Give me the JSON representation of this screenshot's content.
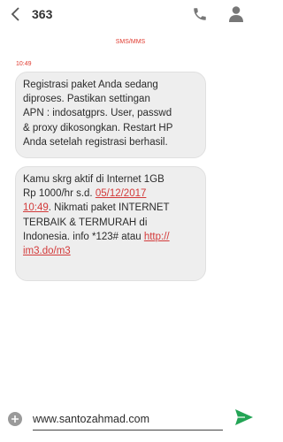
{
  "header": {
    "title": "363"
  },
  "conversation": {
    "channel_label": "SMS/MMS",
    "timestamp": "10:49",
    "messages": [
      {
        "lines": [
          "Registrasi paket Anda sedang",
          "diproses. Pastikan settingan",
          "APN : indosatgprs. User, passwd",
          "& proxy dikosongkan. Restart HP",
          "Anda setelah registrasi berhasil."
        ]
      },
      {
        "line1": "Kamu skrg aktif di Internet 1GB",
        "line2_text": "Rp 1000/hr s.d. ",
        "line2_link": "05/12/2017",
        "line3_link": "10:49",
        "line3_text": ". Nikmati paket INTERNET",
        "line4": "TERBAIK & TERMURAH di",
        "line5_text": "Indonesia. info *123# atau ",
        "line5_link": "http://",
        "line6_link": "im3.do/m3"
      }
    ]
  },
  "compose": {
    "text": "www.santozahmad.com"
  },
  "icons": {
    "back": "chevron-left-icon",
    "call": "phone-icon",
    "contact": "person-icon",
    "add": "plus-icon",
    "send": "send-icon"
  },
  "colors": {
    "accent_red": "#e03a2f",
    "link_red": "#d33a3a",
    "send_green": "#23a455",
    "bubble_bg": "#eeeeee"
  }
}
